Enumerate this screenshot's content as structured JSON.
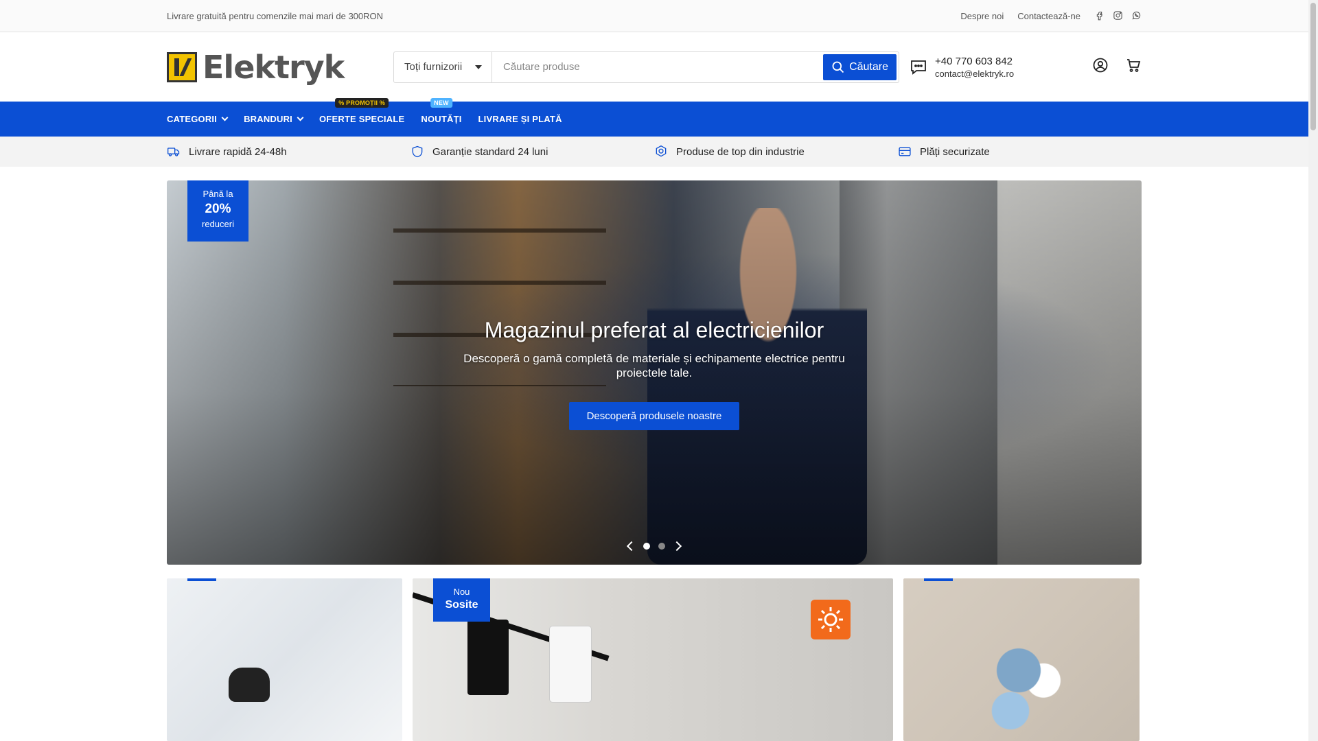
{
  "topbar": {
    "promo": "Livrare gratuită pentru comenzile mai mari de 300RON",
    "links": [
      "Despre noi",
      "Contactează-ne"
    ],
    "socials": [
      "facebook-icon",
      "instagram-icon",
      "whatsapp-icon"
    ]
  },
  "header": {
    "logo_text": "Elektryk",
    "search": {
      "supplier": "Toți furnizorii",
      "placeholder": "Căutare produse",
      "button": "Căutare"
    },
    "contact": {
      "phone": "+40 770 603 842",
      "email": "contact@elektryk.ro"
    }
  },
  "nav": {
    "items": [
      {
        "label": "CATEGORII",
        "dropdown": true
      },
      {
        "label": "BRANDURI",
        "dropdown": true
      },
      {
        "label": "OFERTE SPECIALE",
        "badge": "% PROMOȚII %"
      },
      {
        "label": "NOUTĂȚI",
        "badge": "NEW"
      },
      {
        "label": "LIVRARE ȘI PLATĂ"
      }
    ]
  },
  "features": [
    {
      "icon": "truck-icon",
      "label": "Livrare rapidă 24-48h"
    },
    {
      "icon": "shield-icon",
      "label": "Garanție standard 24 luni"
    },
    {
      "icon": "badge-icon",
      "label": "Produse de top din industrie"
    },
    {
      "icon": "card-icon",
      "label": "Plăți securizate"
    }
  ],
  "hero": {
    "discount": {
      "top": "Până la",
      "value": "20%",
      "bottom": "reduceri"
    },
    "title": "Magazinul preferat al electricienilor",
    "subtitle": "Descoperă o gamă completă de materiale și echipamente electrice pentru proiectele tale.",
    "cta": "Descoperă produsele noastre",
    "slides": 2,
    "active_slide": 1
  },
  "cards": [
    {
      "tag": null
    },
    {
      "tag": {
        "top": "Nou",
        "bottom": "Sosite"
      }
    },
    {
      "tag": null
    }
  ],
  "colors": {
    "brand_blue": "#0b4fd4",
    "promo_yellow": "#f2c300",
    "new_blue": "#4fb3ff",
    "sun_orange": "#f26a1b"
  }
}
